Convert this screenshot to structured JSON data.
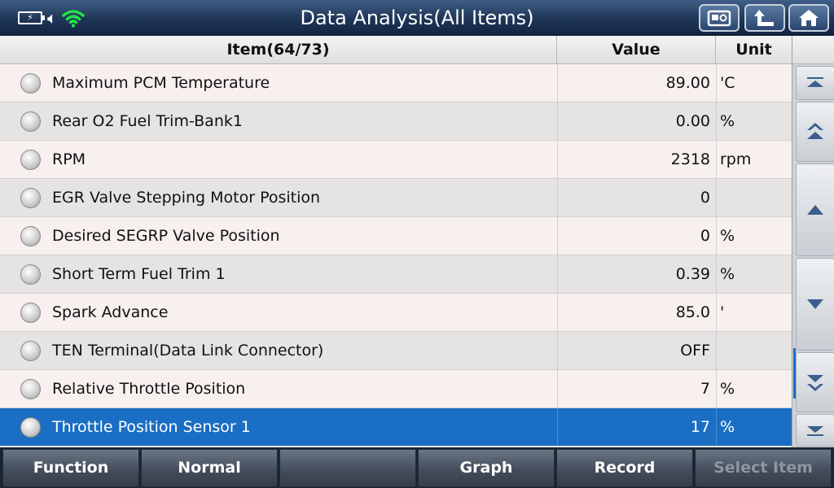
{
  "header": {
    "title": "Data Analysis(All Items)",
    "status_icons": [
      "battery-charging-icon",
      "speaker-icon",
      "wifi-icon"
    ],
    "buttons": [
      {
        "name": "screenshot-button",
        "icon": "camera-card-icon"
      },
      {
        "name": "back-button",
        "icon": "return-arrow-icon"
      },
      {
        "name": "home-button",
        "icon": "home-icon"
      }
    ]
  },
  "table": {
    "columns": {
      "item": "Item(64/73)",
      "value": "Value",
      "unit": "Unit"
    },
    "rows": [
      {
        "item": "Maximum PCM Temperature",
        "value": "89.00",
        "unit": "'C"
      },
      {
        "item": "Rear O2 Fuel Trim-Bank1",
        "value": "0.00",
        "unit": "%"
      },
      {
        "item": "RPM",
        "value": "2318",
        "unit": "rpm"
      },
      {
        "item": "EGR Valve Stepping Motor Position",
        "value": "0",
        "unit": ""
      },
      {
        "item": "Desired SEGRP Valve Position",
        "value": "0",
        "unit": "%"
      },
      {
        "item": "Short Term Fuel Trim 1",
        "value": "0.39",
        "unit": "%"
      },
      {
        "item": "Spark Advance",
        "value": "85.0",
        "unit": "'"
      },
      {
        "item": "TEN Terminal(Data Link Connector)",
        "value": "OFF",
        "unit": ""
      },
      {
        "item": "Relative Throttle Position",
        "value": "7",
        "unit": "%"
      },
      {
        "item": "Throttle Position Sensor 1",
        "value": "17",
        "unit": "%"
      }
    ],
    "selected_index": 9
  },
  "scroll": {
    "buttons": [
      "scroll-top-icon",
      "page-up-icon",
      "arrow-up-icon",
      "arrow-down-icon",
      "page-down-icon",
      "scroll-bottom-icon"
    ]
  },
  "toolbar": {
    "function_label": "Function",
    "normal_label": "Normal",
    "empty_label": "",
    "graph_label": "Graph",
    "record_label": "Record",
    "select_item_label": "Select Item"
  },
  "colors": {
    "accent": "#1a6ec4",
    "title_bar": "#1f3557",
    "row_odd": "#f7f0ef",
    "row_even": "#e6e3e3",
    "wifi": "#22e04a"
  }
}
